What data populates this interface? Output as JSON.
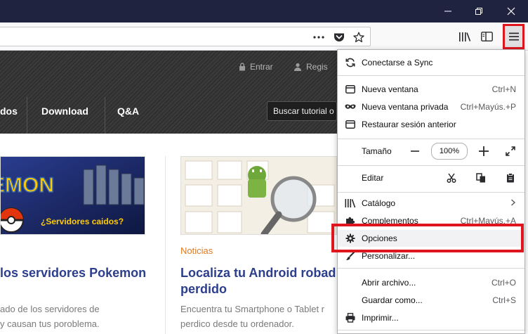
{
  "site": {
    "header_links": {
      "login": "Entrar",
      "register": "Regis"
    },
    "nav": {
      "item_partial": "dos",
      "download": "Download",
      "qa": "Q&A"
    },
    "search_placeholder": "Buscar tutorial o",
    "cards": [
      {
        "banner_text": "EMON",
        "banner_subtitle": "¿Servidores caidos?",
        "title": "los servidores Pokemon",
        "description": "ado de los servidores de\ny causan tus poroblema."
      },
      {
        "category": "Noticias",
        "title": "Localiza tu Android robad\nperdido",
        "description": "Encuentra tu Smartphone o Tablet r\nperdico desde tu ordenador."
      }
    ]
  },
  "menu": {
    "sync": "Conectarse a Sync",
    "new_window": {
      "label": "Nueva ventana",
      "shortcut": "Ctrl+N"
    },
    "private_window": {
      "label": "Nueva ventana privada",
      "shortcut": "Ctrl+Mayús.+P"
    },
    "restore_session": "Restaurar sesión anterior",
    "zoom": {
      "label": "Tamaño",
      "level": "100%"
    },
    "edit": "Editar",
    "library": "Catálogo",
    "addons": {
      "label": "Complementos",
      "shortcut": "Ctrl+Mayús.+A"
    },
    "options": "Opciones",
    "customize": "Personalizar...",
    "open_file": {
      "label": "Abrir archivo...",
      "shortcut": "Ctrl+O"
    },
    "save_as": {
      "label": "Guardar como...",
      "shortcut": "Ctrl+S"
    },
    "print": "Imprimir..."
  },
  "colors": {
    "titlebar": "#202340",
    "highlight": "#e0161f",
    "link_title": "#2c3e8c",
    "category": "#e07b24"
  }
}
